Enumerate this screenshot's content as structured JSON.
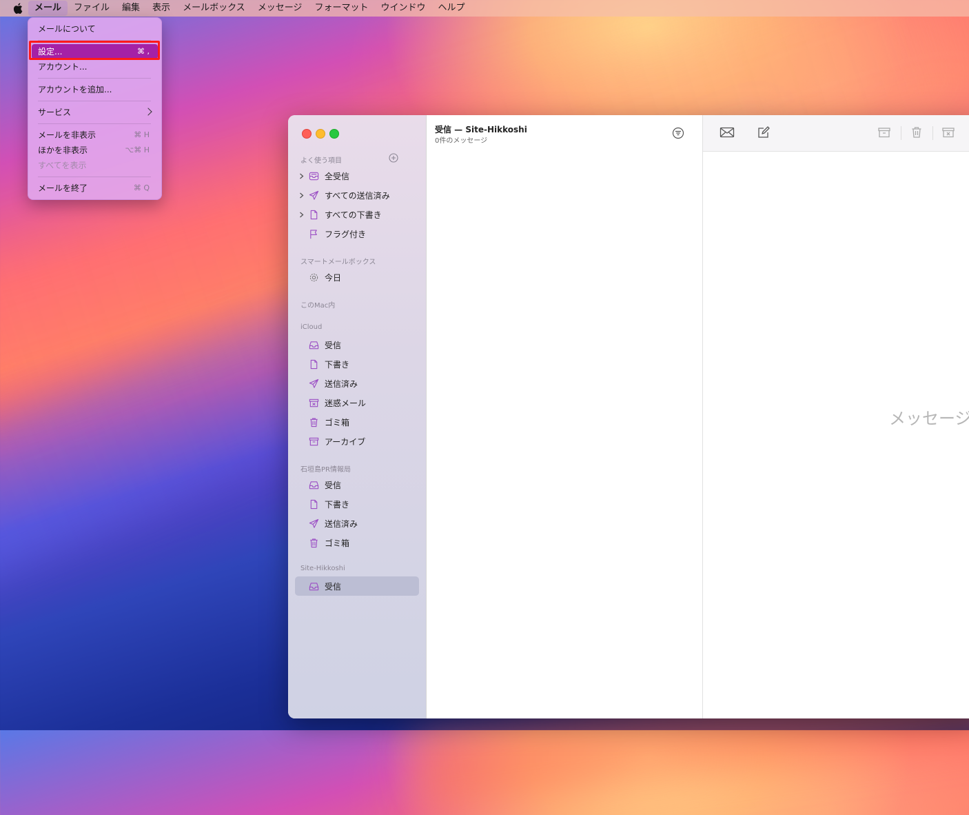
{
  "menubar": {
    "items": [
      "メール",
      "ファイル",
      "編集",
      "表示",
      "メールボックス",
      "メッセージ",
      "フォーマット",
      "ウインドウ",
      "ヘルプ"
    ]
  },
  "mail_menu": {
    "about": "メールについて",
    "settings": {
      "label": "設定...",
      "shortcut": "⌘ ,"
    },
    "accounts": "アカウント...",
    "add_account": "アカウントを追加...",
    "services": "サービス",
    "hide_mail": {
      "label": "メールを非表示",
      "shortcut": "⌘ H"
    },
    "hide_others": {
      "label": "ほかを非表示",
      "shortcut": "⌥⌘ H"
    },
    "show_all": "すべてを表示",
    "quit": {
      "label": "メールを終了",
      "shortcut": "⌘ Q"
    }
  },
  "sidebar": {
    "favorites_header": "よく使う項目",
    "favorites": [
      "全受信",
      "すべての送信済み",
      "すべての下書き",
      "フラグ付き"
    ],
    "smart_header": "スマートメールボックス",
    "smart": [
      "今日"
    ],
    "mac_header": "このMac内",
    "icloud_header": "iCloud",
    "icloud": [
      "受信",
      "下書き",
      "送信済み",
      "迷惑メール",
      "ゴミ箱",
      "アーカイブ"
    ],
    "ishigaki_header": "石垣島PR情報局",
    "ishigaki": [
      "受信",
      "下書き",
      "送信済み",
      "ゴミ箱"
    ],
    "hikkoshi_header": "Site-Hikkoshi",
    "hikkoshi": [
      "受信"
    ]
  },
  "message_list": {
    "title": "受信 — Site-Hikkoshi",
    "subtitle": "0件のメッセージ"
  },
  "reader": {
    "empty_text": "メッセージ"
  },
  "colors": {
    "accent": "#a521a6",
    "highlight_box": "#ff1a1a",
    "icon_purple": "#9b4fc4"
  }
}
